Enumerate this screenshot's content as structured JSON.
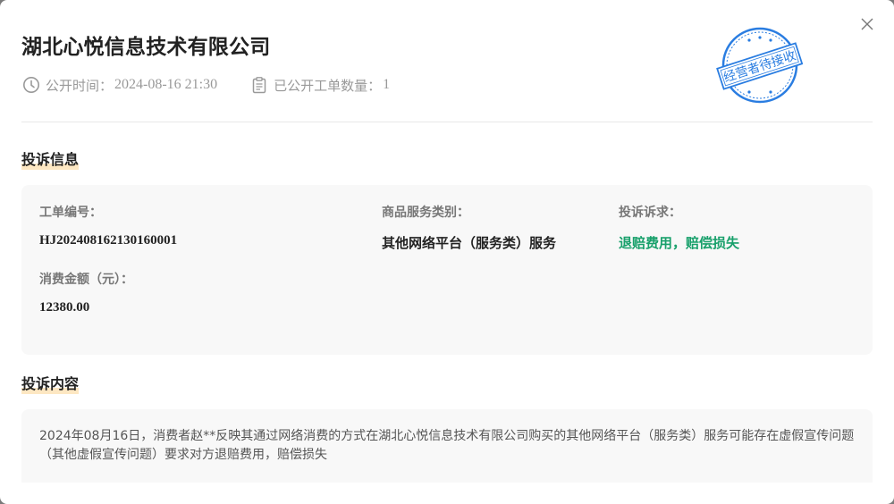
{
  "header": {
    "company_name": "湖北心悦信息技术有限公司",
    "publish_label": "公开时间：",
    "publish_time": "2024-08-16 21:30",
    "orders_label": "已公开工单数量：",
    "orders_count": "1",
    "stamp_text": "经营者待接收",
    "stamp_color": "#2a7de1",
    "close_icon": "close-icon"
  },
  "complaint_info": {
    "section_title": "投诉信息",
    "fields": [
      {
        "label": "工单编号：",
        "value": "HJ20240816213016000​1"
      },
      {
        "label": "商品服务类别：",
        "value": "其他网络平台（服务类）服务"
      },
      {
        "label": "投诉诉求：",
        "value": "退赔费用，赔偿损失"
      },
      {
        "label": "消费金额（元）：",
        "value": "12380.00"
      }
    ],
    "accent_color": "#18a06b"
  },
  "complaint_content": {
    "section_title": "投诉内容",
    "text": "2024年08月16日，消费者赵**反映其通过网络消费的方式在湖北心悦信息技术有限公司购买的其他网络平台（服务类）服务可能存在虚假宣传问题（其他虚假宣传问题）要求对方退赔费用，赔偿损失"
  }
}
